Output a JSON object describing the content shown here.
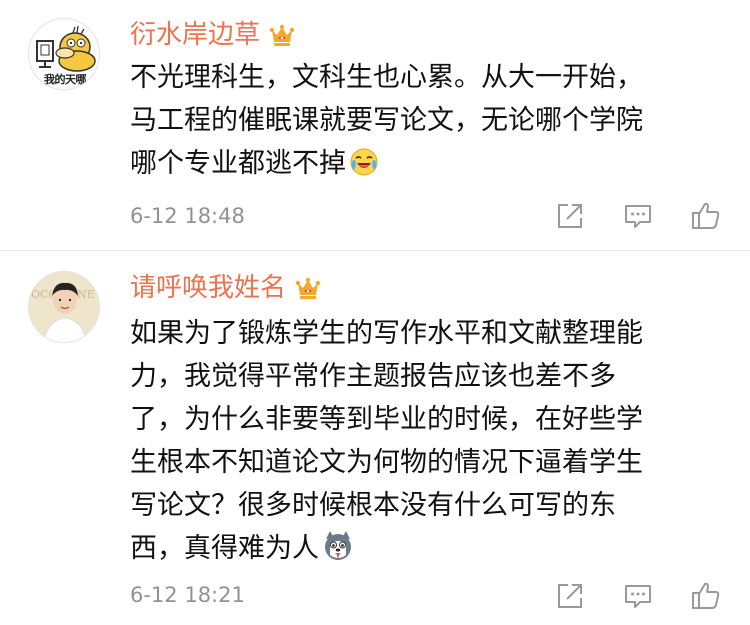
{
  "comments": [
    {
      "username": "衍水岸边草",
      "badge": "crown-badge-icon",
      "avatar_text": "我的天哪",
      "text_lines": [
        "不光理科生，文科生也心累。从大一开始，",
        "马工程的催眠课就要写论文，无论哪个学院",
        "哪个专业都逃不掉"
      ],
      "inline_emoji": "laughing-crying-emoji-icon",
      "timestamp": "6-12 18:48",
      "actions": [
        "repost-icon",
        "comment-icon",
        "like-icon"
      ]
    },
    {
      "username": "请呼唤我姓名",
      "badge": "crown-badge-icon",
      "avatar_text": "",
      "text_lines": [
        "如果为了锻炼学生的写作水平和文献整理能",
        "力，我觉得平常作主题报告应该也差不多",
        "了，为什么非要等到毕业的时候，在好些学",
        "生根本不知道论文为何物的情况下逼着学生",
        "写论文？很多时候根本没有什么可写的东",
        "西，真得难为人"
      ],
      "inline_emoji": "husky-dog-emoji-icon",
      "timestamp": "6-12 18:21",
      "actions": [
        "repost-icon",
        "comment-icon",
        "like-icon"
      ]
    }
  ],
  "colors": {
    "username": "#eb7350",
    "timestamp": "#929292",
    "icon": "#9a9a9a",
    "crown": "#f4a82c",
    "divider": "#e6e6e6"
  }
}
